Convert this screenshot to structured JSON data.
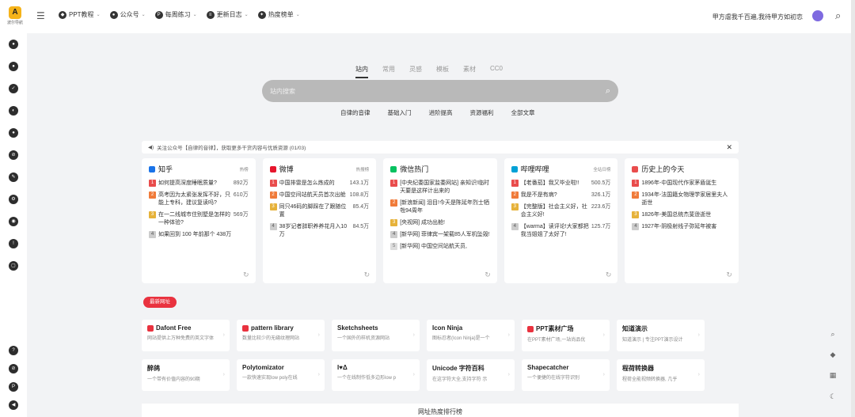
{
  "logo": {
    "text": "波尔导航"
  },
  "nav": [
    {
      "label": "PPT教程",
      "icon": "ppt"
    },
    {
      "label": "公众号",
      "icon": "wechat"
    },
    {
      "label": "每周练习",
      "icon": "p"
    },
    {
      "label": "更新日志",
      "icon": "log"
    },
    {
      "label": "热度榜单",
      "icon": "hot"
    }
  ],
  "topbar_right": "甲方虐我千百遍,我待甲方如初恋",
  "search": {
    "tabs": [
      "站内",
      "常用",
      "灵感",
      "模板",
      "素材",
      "CC0"
    ],
    "placeholder": "站内搜索",
    "quick": [
      "自律的音律",
      "基础入门",
      "进阶提高",
      "资源福利",
      "全部文章"
    ]
  },
  "notice": "关注公众号【自律的音律】，获取更多干货内容与优质资源 (01/03)",
  "hot": [
    {
      "name": "知乎",
      "tag": "热榜",
      "color": "#1a73e8",
      "items": [
        {
          "text": "如何提高深度睡眠质量?",
          "val": "892万"
        },
        {
          "text": "高考因为太紧张发挥不好，只能上专科，建议复读吗?",
          "val": "610万"
        },
        {
          "text": "在一二线城市住别墅是怎样的一种体验?",
          "val": "569万"
        },
        {
          "text": "如果回到 100 年前那个 438万",
          "val": ""
        }
      ]
    },
    {
      "name": "微博",
      "tag": "热搜榜",
      "color": "#e6162d",
      "items": [
        {
          "text": "中国排雷是怎么炼成的",
          "val": "143.1万"
        },
        {
          "text": "中国空间站航天员首次出舱",
          "val": "108.8万"
        },
        {
          "text": "同只46码的脚踩在了跟随位置",
          "val": "85.4万"
        },
        {
          "text": "38岁记者辞职养养花月入10万",
          "val": "84.5万"
        }
      ]
    },
    {
      "name": "微信热门",
      "tag": "",
      "color": "#07c160",
      "items": [
        {
          "text": "[中央纪委国家监委网站] 亲知识!临时天要是这样计出来的",
          "val": ""
        },
        {
          "text": "[新浪新闻] 泪目!今天是陈延年烈士牺牲94周年",
          "val": ""
        },
        {
          "text": "[央视网] 成功出舱!",
          "val": ""
        },
        {
          "text": "[新华网] 菲律宾一架载85人军机坠毁!",
          "val": ""
        },
        {
          "text": "[新华网] 中国空间站航天员,",
          "val": ""
        }
      ]
    },
    {
      "name": "哔哩哔哩",
      "tag": "全站日榜",
      "color": "#00a1d6",
      "items": [
        {
          "text": "【老番茄】我又毕业啦!!",
          "val": "500.5万"
        },
        {
          "text": "我是不是有病?",
          "val": "326.1万"
        },
        {
          "text": "【完整版】社会主义好，社会主义好!",
          "val": "223.6万"
        },
        {
          "text": "【warma】读评论!大家都把我当姐姐了太好了!",
          "val": "125.7万"
        }
      ]
    },
    {
      "name": "历史上的今天",
      "tag": "",
      "color": "#e94c4c",
      "items": [
        {
          "text": "1896年-中国现代作家茅盾诞生",
          "val": ""
        },
        {
          "text": "1934年-法国籍女物理学家居里夫人逝世",
          "val": ""
        },
        {
          "text": "1826年-美国总统杰斐逊逝世",
          "val": ""
        },
        {
          "text": "1927年-阴极射线子弥延年被害",
          "val": ""
        }
      ]
    }
  ],
  "new_badge": "最新网址",
  "sites": [
    [
      {
        "name": "Dafont Free",
        "desc": "网站提供上万种免费的英文字体"
      },
      {
        "name": "pattern library",
        "desc": "数量比较少的无缝纹理网站"
      },
      {
        "name": "Sketchsheets",
        "desc": "一个国外的样机资源网站"
      },
      {
        "name": "Icon Ninja",
        "desc": "图标忍者(Icon Ninja)是一个"
      },
      {
        "name": "PPT素材广场",
        "desc": "在PPT素材广场,一站尚品优"
      },
      {
        "name": "知道演示",
        "desc": "知道演示 | 专注PPT演示设计"
      }
    ],
    [
      {
        "name": "醉鸽",
        "desc": "一个带有价值内容的90期"
      },
      {
        "name": "Polytomizator",
        "desc": "一款快速实现low poly在线"
      },
      {
        "name": "I♥Δ",
        "desc": "一个在线制作低多边形low p"
      },
      {
        "name": "Unicode 字符百科",
        "desc": "在这字符大全,支持字符 示"
      },
      {
        "name": "Shapecatcher",
        "desc": "一个便捷的在线字符识别"
      },
      {
        "name": "程荷转换器",
        "desc": "程荷全能视频转换器, 几乎"
      }
    ]
  ],
  "rank_title": "网址热度排行榜"
}
